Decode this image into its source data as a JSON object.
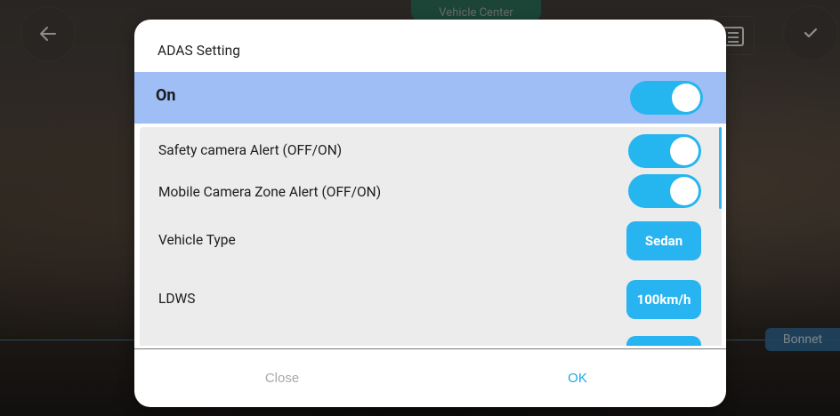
{
  "background": {
    "top_chip": "Vehicle Center",
    "bonnet_label": "Bonnet"
  },
  "dialog": {
    "title": "ADAS Setting",
    "master": {
      "label": "On",
      "state": "on"
    },
    "items": [
      {
        "label": "Safety camera Alert (OFF/ON)",
        "control": "toggle",
        "state": "on"
      },
      {
        "label": "Mobile Camera Zone Alert (OFF/ON)",
        "control": "toggle",
        "state": "on"
      },
      {
        "label": "Vehicle Type",
        "control": "button",
        "value": "Sedan"
      },
      {
        "label": "LDWS",
        "control": "button",
        "value": "100km/h"
      }
    ],
    "footer": {
      "close_label": "Close",
      "ok_label": "OK"
    }
  },
  "colors": {
    "accent": "#25b5ef",
    "master_row_bg": "#9fbef5",
    "ok_text": "#1ea6e8",
    "close_text": "#a8a8a8"
  },
  "icons": [
    "back-arrow-icon",
    "settings-icon",
    "check-icon"
  ]
}
